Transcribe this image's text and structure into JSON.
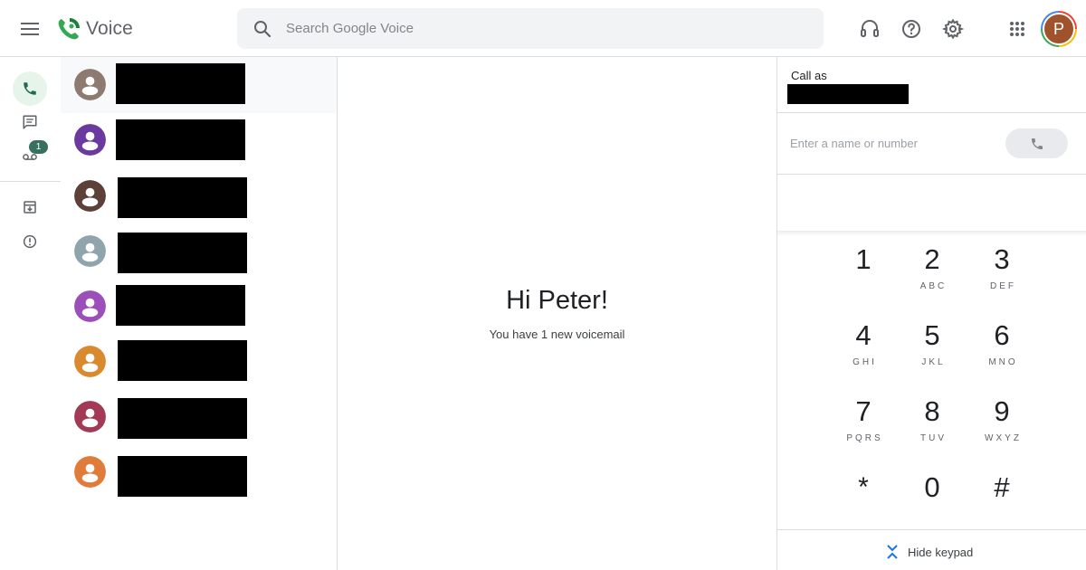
{
  "header": {
    "app_name": "Voice",
    "search_placeholder": "Search Google Voice",
    "avatar_initial": "P",
    "icons": [
      "menu-icon",
      "voice-logo-icon",
      "search-icon",
      "headset-icon",
      "help-icon",
      "gear-icon",
      "apps-grid-icon"
    ]
  },
  "nav": {
    "items": [
      {
        "name": "calls",
        "icon": "phone-icon",
        "active": true
      },
      {
        "name": "messages",
        "icon": "message-icon",
        "active": false
      },
      {
        "name": "voicemail",
        "icon": "voicemail-icon",
        "active": false
      },
      {
        "name": "archive",
        "icon": "archive-icon",
        "active": false
      },
      {
        "name": "spam",
        "icon": "spam-icon",
        "active": false
      }
    ],
    "voicemail_badge": "1"
  },
  "contacts": [
    {
      "color": "#8d7b72",
      "redacted": true
    },
    {
      "color": "#6a3aa0",
      "redacted": true
    },
    {
      "color": "#5d4037",
      "redacted": true
    },
    {
      "color": "#90a4ae",
      "redacted": true
    },
    {
      "color": "#9c4fb8",
      "redacted": true
    },
    {
      "color": "#d98a2e",
      "redacted": true
    },
    {
      "color": "#a33a55",
      "redacted": true
    },
    {
      "color": "#e07b39",
      "redacted": true
    }
  ],
  "main": {
    "greeting": "Hi Peter!",
    "subtitle": "You have 1 new voicemail"
  },
  "dialer": {
    "call_as_label": "Call as",
    "number_placeholder": "Enter a name or number",
    "keys": [
      {
        "digit": "1",
        "letters": ""
      },
      {
        "digit": "2",
        "letters": "ABC"
      },
      {
        "digit": "3",
        "letters": "DEF"
      },
      {
        "digit": "4",
        "letters": "GHI"
      },
      {
        "digit": "5",
        "letters": "JKL"
      },
      {
        "digit": "6",
        "letters": "MNO"
      },
      {
        "digit": "7",
        "letters": "PQRS"
      },
      {
        "digit": "8",
        "letters": "TUV"
      },
      {
        "digit": "9",
        "letters": "WXYZ"
      },
      {
        "digit": "*",
        "letters": ""
      },
      {
        "digit": "0",
        "letters": ""
      },
      {
        "digit": "#",
        "letters": ""
      }
    ],
    "hide_keypad_label": "Hide keypad"
  },
  "colors": {
    "accent_green": "#38705f",
    "active_nav_bg": "#e6f4ea",
    "avatar_bg": "#a0522d",
    "redaction": "#000000"
  }
}
